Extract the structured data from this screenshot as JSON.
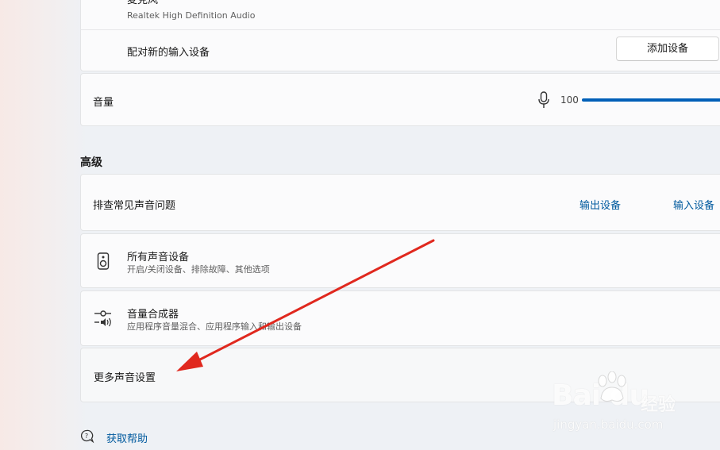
{
  "input_device": {
    "name_partial": "麦克风",
    "driver": "Realtek High Definition Audio"
  },
  "pair_device": {
    "label": "配对新的输入设备",
    "button": "添加设备"
  },
  "volume": {
    "label": "音量",
    "value": "100",
    "level_percent": 100
  },
  "advanced": {
    "heading": "高级",
    "troubleshoot": {
      "label": "排查常见声音问题",
      "output_link": "输出设备",
      "input_link": "输入设备"
    },
    "all_devices": {
      "title": "所有声音设备",
      "subtitle": "开启/关闭设备、排除故障、其他选项"
    },
    "mixer": {
      "title": "音量合成器",
      "subtitle": "应用程序音量混合、应用程序输入和输出设备"
    },
    "more_settings": {
      "label": "更多声音设置"
    }
  },
  "help": {
    "label": "获取帮助"
  },
  "watermark": {
    "brand": "Bai du",
    "product": "经验",
    "url": "jingyan.baidu.com"
  },
  "colors": {
    "accent": "#005fb8",
    "link": "#005a9e",
    "arrow": "#e0281e"
  }
}
